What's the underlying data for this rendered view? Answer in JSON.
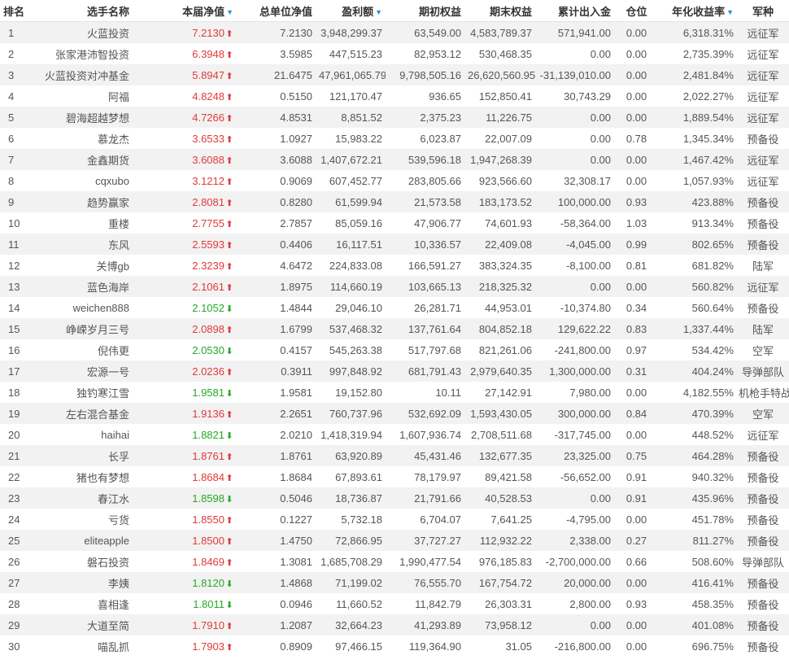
{
  "headers": {
    "rank": "排名",
    "name": "选手名称",
    "nav": "本届净值",
    "unit_nav": "总单位净值",
    "profit": "盈利额",
    "start_equity": "期初权益",
    "end_equity": "期末权益",
    "cum_flow": "累计出入金",
    "position": "仓位",
    "annual_yield": "年化收益率",
    "army": "军种"
  },
  "icons": {
    "sort": "sort-down-icon",
    "up": "arrow-up-icon",
    "down": "arrow-down-icon"
  },
  "colors": {
    "up": "#e03a3a",
    "down": "#26a826",
    "sort": "#2a8fd6",
    "stripe": "#f2f2f2"
  },
  "rows": [
    {
      "rank": "1",
      "name": "火蓝投资",
      "nav": "7.2130",
      "dir": "up",
      "unit_nav": "7.2130",
      "profit": "3,948,299.37",
      "start_equity": "63,549.00",
      "end_equity": "4,583,789.37",
      "cum_flow": "571,941.00",
      "position": "0.00",
      "annual_yield": "6,318.31%",
      "army": "远征军"
    },
    {
      "rank": "2",
      "name": "张家港沛智投资",
      "nav": "6.3948",
      "dir": "up",
      "unit_nav": "3.5985",
      "profit": "447,515.23",
      "start_equity": "82,953.12",
      "end_equity": "530,468.35",
      "cum_flow": "0.00",
      "position": "0.00",
      "annual_yield": "2,735.39%",
      "army": "远征军"
    },
    {
      "rank": "3",
      "name": "火蓝投资对冲基金",
      "nav": "5.8947",
      "dir": "up",
      "unit_nav": "21.6475",
      "profit": "47,961,065.79",
      "start_equity": "9,798,505.16",
      "end_equity": "26,620,560.95",
      "cum_flow": "-31,139,010.00",
      "position": "0.00",
      "annual_yield": "2,481.84%",
      "army": "远征军"
    },
    {
      "rank": "4",
      "name": "阿福",
      "nav": "4.8248",
      "dir": "up",
      "unit_nav": "0.5150",
      "profit": "121,170.47",
      "start_equity": "936.65",
      "end_equity": "152,850.41",
      "cum_flow": "30,743.29",
      "position": "0.00",
      "annual_yield": "2,022.27%",
      "army": "远征军"
    },
    {
      "rank": "5",
      "name": "碧海超越梦想",
      "nav": "4.7266",
      "dir": "up",
      "unit_nav": "4.8531",
      "profit": "8,851.52",
      "start_equity": "2,375.23",
      "end_equity": "11,226.75",
      "cum_flow": "0.00",
      "position": "0.00",
      "annual_yield": "1,889.54%",
      "army": "远征军"
    },
    {
      "rank": "6",
      "name": "慕龙杰",
      "nav": "3.6533",
      "dir": "up",
      "unit_nav": "1.0927",
      "profit": "15,983.22",
      "start_equity": "6,023.87",
      "end_equity": "22,007.09",
      "cum_flow": "0.00",
      "position": "0.78",
      "annual_yield": "1,345.34%",
      "army": "预备役"
    },
    {
      "rank": "7",
      "name": "金鑫期货",
      "nav": "3.6088",
      "dir": "up",
      "unit_nav": "3.6088",
      "profit": "1,407,672.21",
      "start_equity": "539,596.18",
      "end_equity": "1,947,268.39",
      "cum_flow": "0.00",
      "position": "0.00",
      "annual_yield": "1,467.42%",
      "army": "远征军"
    },
    {
      "rank": "8",
      "name": "cqxubo",
      "nav": "3.1212",
      "dir": "up",
      "unit_nav": "0.9069",
      "profit": "607,452.77",
      "start_equity": "283,805.66",
      "end_equity": "923,566.60",
      "cum_flow": "32,308.17",
      "position": "0.00",
      "annual_yield": "1,057.93%",
      "army": "远征军"
    },
    {
      "rank": "9",
      "name": "趋势赢家",
      "nav": "2.8081",
      "dir": "up",
      "unit_nav": "0.8280",
      "profit": "61,599.94",
      "start_equity": "21,573.58",
      "end_equity": "183,173.52",
      "cum_flow": "100,000.00",
      "position": "0.93",
      "annual_yield": "423.88%",
      "army": "预备役"
    },
    {
      "rank": "10",
      "name": "重楼",
      "nav": "2.7755",
      "dir": "up",
      "unit_nav": "2.7857",
      "profit": "85,059.16",
      "start_equity": "47,906.77",
      "end_equity": "74,601.93",
      "cum_flow": "-58,364.00",
      "position": "1.03",
      "annual_yield": "913.34%",
      "army": "预备役"
    },
    {
      "rank": "11",
      "name": "东风",
      "nav": "2.5593",
      "dir": "up",
      "unit_nav": "0.4406",
      "profit": "16,117.51",
      "start_equity": "10,336.57",
      "end_equity": "22,409.08",
      "cum_flow": "-4,045.00",
      "position": "0.99",
      "annual_yield": "802.65%",
      "army": "预备役"
    },
    {
      "rank": "12",
      "name": "关博gb",
      "nav": "2.3239",
      "dir": "up",
      "unit_nav": "4.6472",
      "profit": "224,833.08",
      "start_equity": "166,591.27",
      "end_equity": "383,324.35",
      "cum_flow": "-8,100.00",
      "position": "0.81",
      "annual_yield": "681.82%",
      "army": "陆军"
    },
    {
      "rank": "13",
      "name": "蓝色海岸",
      "nav": "2.1061",
      "dir": "up",
      "unit_nav": "1.8975",
      "profit": "114,660.19",
      "start_equity": "103,665.13",
      "end_equity": "218,325.32",
      "cum_flow": "0.00",
      "position": "0.00",
      "annual_yield": "560.82%",
      "army": "远征军"
    },
    {
      "rank": "14",
      "name": "weichen888",
      "nav": "2.1052",
      "dir": "down",
      "unit_nav": "1.4844",
      "profit": "29,046.10",
      "start_equity": "26,281.71",
      "end_equity": "44,953.01",
      "cum_flow": "-10,374.80",
      "position": "0.34",
      "annual_yield": "560.64%",
      "army": "预备役"
    },
    {
      "rank": "15",
      "name": "峥嵘岁月三号",
      "nav": "2.0898",
      "dir": "up",
      "unit_nav": "1.6799",
      "profit": "537,468.32",
      "start_equity": "137,761.64",
      "end_equity": "804,852.18",
      "cum_flow": "129,622.22",
      "position": "0.83",
      "annual_yield": "1,337.44%",
      "army": "陆军"
    },
    {
      "rank": "16",
      "name": "倪伟更",
      "nav": "2.0530",
      "dir": "down",
      "unit_nav": "0.4157",
      "profit": "545,263.38",
      "start_equity": "517,797.68",
      "end_equity": "821,261.06",
      "cum_flow": "-241,800.00",
      "position": "0.97",
      "annual_yield": "534.42%",
      "army": "空军"
    },
    {
      "rank": "17",
      "name": "宏源一号",
      "nav": "2.0236",
      "dir": "up",
      "unit_nav": "0.3911",
      "profit": "997,848.92",
      "start_equity": "681,791.43",
      "end_equity": "2,979,640.35",
      "cum_flow": "1,300,000.00",
      "position": "0.31",
      "annual_yield": "404.24%",
      "army": "导弹部队"
    },
    {
      "rank": "18",
      "name": "独钓寒江雪",
      "nav": "1.9581",
      "dir": "down",
      "unit_nav": "1.9581",
      "profit": "19,152.80",
      "start_equity": "10.11",
      "end_equity": "27,142.91",
      "cum_flow": "7,980.00",
      "position": "0.00",
      "annual_yield": "4,182.55%",
      "army": "机枪手特战营"
    },
    {
      "rank": "19",
      "name": "左右混合基金",
      "nav": "1.9136",
      "dir": "up",
      "unit_nav": "2.2651",
      "profit": "760,737.96",
      "start_equity": "532,692.09",
      "end_equity": "1,593,430.05",
      "cum_flow": "300,000.00",
      "position": "0.84",
      "annual_yield": "470.39%",
      "army": "空军"
    },
    {
      "rank": "20",
      "name": "haihai",
      "nav": "1.8821",
      "dir": "down",
      "unit_nav": "2.0210",
      "profit": "1,418,319.94",
      "start_equity": "1,607,936.74",
      "end_equity": "2,708,511.68",
      "cum_flow": "-317,745.00",
      "position": "0.00",
      "annual_yield": "448.52%",
      "army": "远征军"
    },
    {
      "rank": "21",
      "name": "长孚",
      "nav": "1.8761",
      "dir": "up",
      "unit_nav": "1.8761",
      "profit": "63,920.89",
      "start_equity": "45,431.46",
      "end_equity": "132,677.35",
      "cum_flow": "23,325.00",
      "position": "0.75",
      "annual_yield": "464.28%",
      "army": "预备役"
    },
    {
      "rank": "22",
      "name": "猪也有梦想",
      "nav": "1.8684",
      "dir": "up",
      "unit_nav": "1.8684",
      "profit": "67,893.61",
      "start_equity": "78,179.97",
      "end_equity": "89,421.58",
      "cum_flow": "-56,652.00",
      "position": "0.91",
      "annual_yield": "940.32%",
      "army": "预备役"
    },
    {
      "rank": "23",
      "name": "春江水",
      "nav": "1.8598",
      "dir": "down",
      "unit_nav": "0.5046",
      "profit": "18,736.87",
      "start_equity": "21,791.66",
      "end_equity": "40,528.53",
      "cum_flow": "0.00",
      "position": "0.91",
      "annual_yield": "435.96%",
      "army": "预备役"
    },
    {
      "rank": "24",
      "name": "亏货",
      "nav": "1.8550",
      "dir": "up",
      "unit_nav": "0.1227",
      "profit": "5,732.18",
      "start_equity": "6,704.07",
      "end_equity": "7,641.25",
      "cum_flow": "-4,795.00",
      "position": "0.00",
      "annual_yield": "451.78%",
      "army": "预备役"
    },
    {
      "rank": "25",
      "name": "eliteapple",
      "nav": "1.8500",
      "dir": "up",
      "unit_nav": "1.4750",
      "profit": "72,866.95",
      "start_equity": "37,727.27",
      "end_equity": "112,932.22",
      "cum_flow": "2,338.00",
      "position": "0.27",
      "annual_yield": "811.27%",
      "army": "预备役"
    },
    {
      "rank": "26",
      "name": "磐石投资",
      "nav": "1.8469",
      "dir": "up",
      "unit_nav": "1.3081",
      "profit": "1,685,708.29",
      "start_equity": "1,990,477.54",
      "end_equity": "976,185.83",
      "cum_flow": "-2,700,000.00",
      "position": "0.66",
      "annual_yield": "508.60%",
      "army": "导弹部队"
    },
    {
      "rank": "27",
      "name": "李姨",
      "nav": "1.8120",
      "dir": "down",
      "unit_nav": "1.4868",
      "profit": "71,199.02",
      "start_equity": "76,555.70",
      "end_equity": "167,754.72",
      "cum_flow": "20,000.00",
      "position": "0.00",
      "annual_yield": "416.41%",
      "army": "预备役"
    },
    {
      "rank": "28",
      "name": "喜相逢",
      "nav": "1.8011",
      "dir": "down",
      "unit_nav": "0.0946",
      "profit": "11,660.52",
      "start_equity": "11,842.79",
      "end_equity": "26,303.31",
      "cum_flow": "2,800.00",
      "position": "0.93",
      "annual_yield": "458.35%",
      "army": "预备役"
    },
    {
      "rank": "29",
      "name": "大道至简",
      "nav": "1.7910",
      "dir": "up",
      "unit_nav": "1.2087",
      "profit": "32,664.23",
      "start_equity": "41,293.89",
      "end_equity": "73,958.12",
      "cum_flow": "0.00",
      "position": "0.00",
      "annual_yield": "401.08%",
      "army": "预备役"
    },
    {
      "rank": "30",
      "name": "喵乱抓",
      "nav": "1.7903",
      "dir": "up",
      "unit_nav": "0.8909",
      "profit": "97,466.15",
      "start_equity": "119,364.90",
      "end_equity": "31.05",
      "cum_flow": "-216,800.00",
      "position": "0.00",
      "annual_yield": "696.75%",
      "army": "预备役"
    }
  ]
}
